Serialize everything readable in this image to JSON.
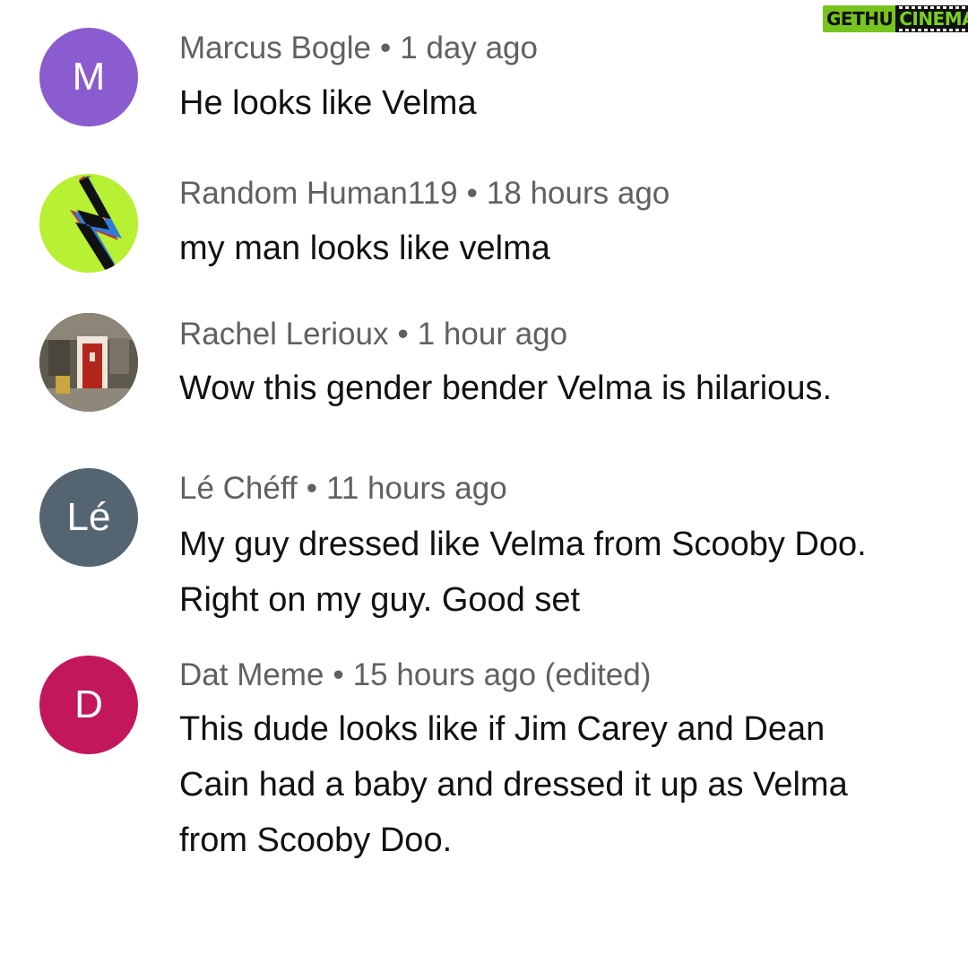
{
  "watermark": {
    "part1": "GETHU",
    "part2": "CINEMA"
  },
  "comments": [
    {
      "author": "Marcus Bogle",
      "time": "1 day ago",
      "avatar_letter": "M",
      "avatar_color": "#8a5ccf",
      "lines": [
        "He looks like Velma"
      ]
    },
    {
      "author": "Random Human119",
      "time": "18 hours ago",
      "avatar_icon": "lightning-bolt-icon",
      "avatar_color": "#b8f033",
      "lines": [
        "my man looks like velma"
      ]
    },
    {
      "author": "Rachel Lerioux",
      "time": "1 hour ago",
      "avatar_icon": "red-door-photo",
      "lines": [
        "Wow this gender bender Velma is hilarious."
      ]
    },
    {
      "author": "Lé Chéff",
      "time": "11 hours ago",
      "avatar_letter": "Lé",
      "avatar_color": "#546571",
      "lines": [
        "My guy dressed like Velma from Scooby Doo.",
        "Right on my guy. Good set"
      ]
    },
    {
      "author": "Dat Meme",
      "time": "15 hours ago (edited)",
      "avatar_letter": "D",
      "avatar_color": "#c2185b",
      "lines": [
        "This dude looks like if Jim Carey and Dean",
        "Cain had a baby and dressed it up as Velma",
        "from Scooby Doo."
      ]
    }
  ]
}
